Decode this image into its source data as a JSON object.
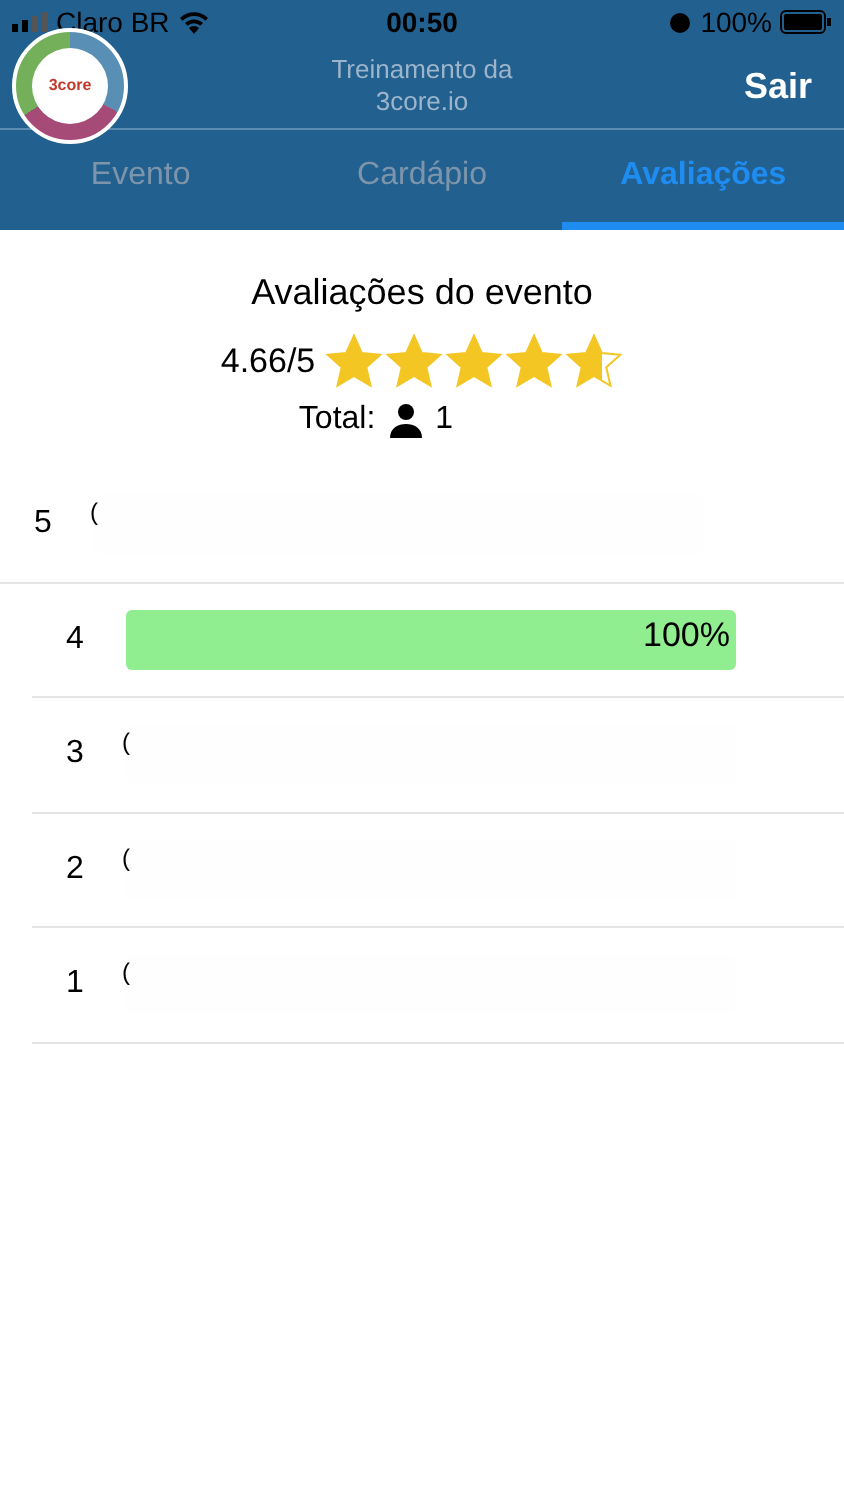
{
  "status_bar": {
    "carrier": "Claro BR",
    "time": "00:50",
    "battery": "100%"
  },
  "header": {
    "logo_text": "3core",
    "title": "Treinamento da 3core.io",
    "action": "Sair"
  },
  "tabs": [
    {
      "label": "Evento",
      "selected": false
    },
    {
      "label": "Cardápio",
      "selected": false
    },
    {
      "label": "Avaliações",
      "selected": true
    }
  ],
  "summary": {
    "title": "Avaliações do evento",
    "score": "4.66/5",
    "stars": 4.66,
    "total_label": "Total:",
    "total": "1"
  },
  "rows": [
    {
      "rating": "5",
      "label": "(",
      "level": 0
    },
    {
      "rating": "4",
      "label": "100%",
      "level": 1
    },
    {
      "rating": "3",
      "label": "(",
      "level": 0
    },
    {
      "rating": "2",
      "label": "(",
      "level": 0
    },
    {
      "rating": "1",
      "label": "(",
      "level": 0
    }
  ]
}
